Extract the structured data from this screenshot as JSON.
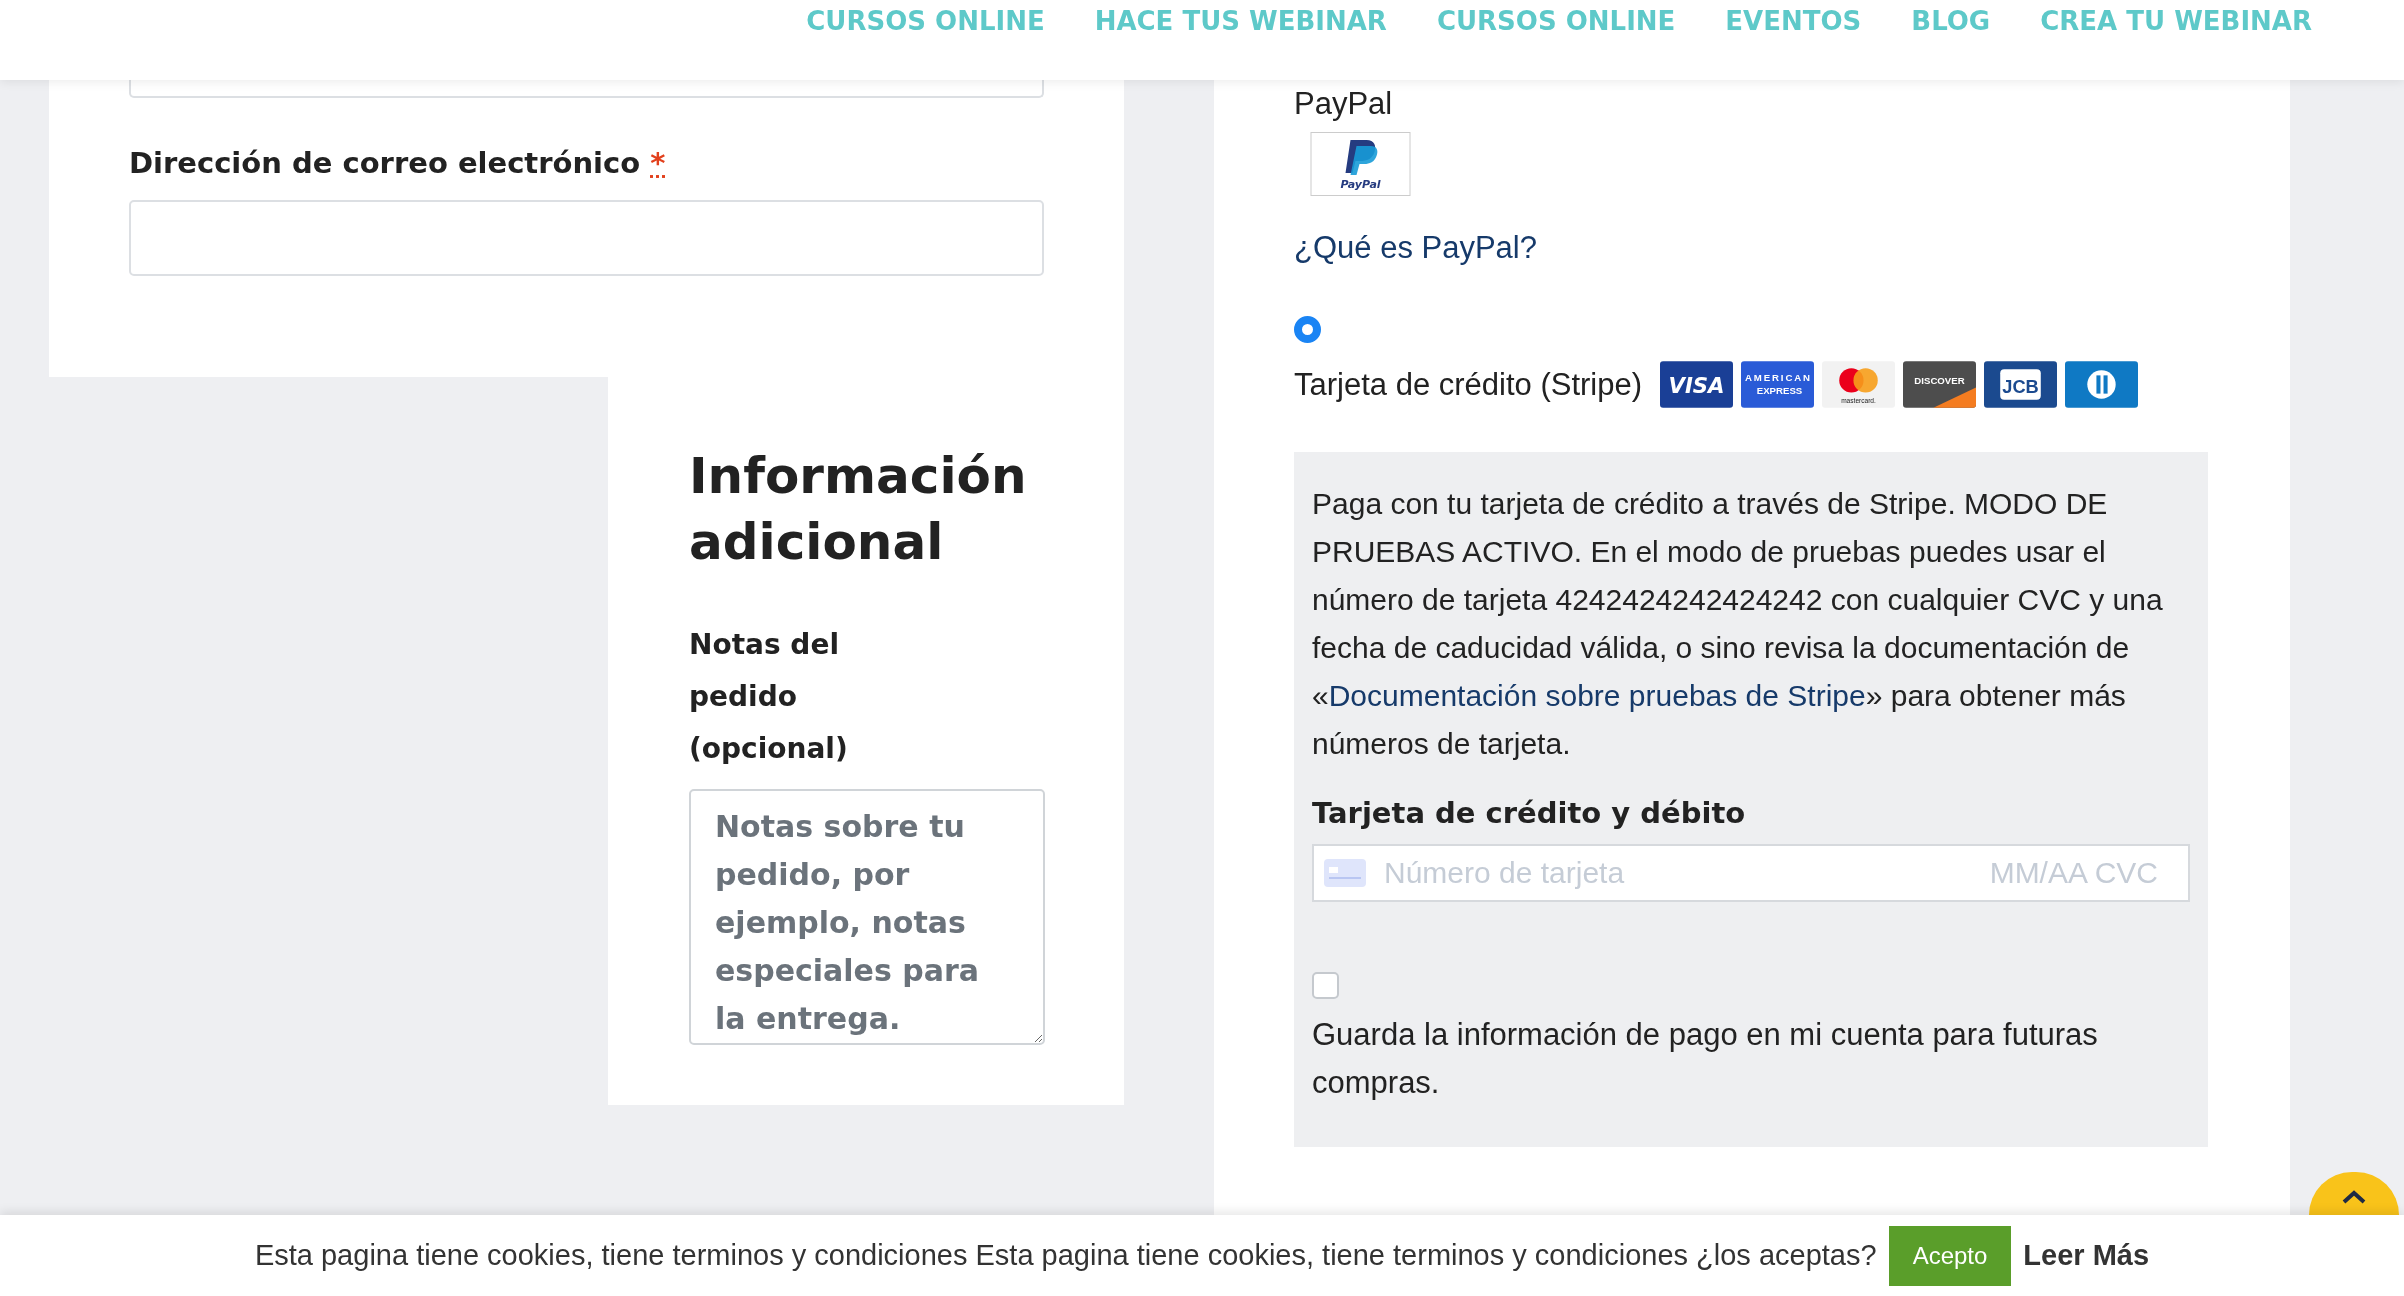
{
  "nav": [
    "CURSOS ONLINE",
    "HACE TUS WEBINAR",
    "CURSOS ONLINE",
    "EVENTOS",
    "BLOG",
    "CREA TU WEBINAR"
  ],
  "billing": {
    "email_label": "Dirección de correo electrónico",
    "required_mark": "*"
  },
  "additional": {
    "title": "Información adicional",
    "notes_label": "Notas del pedido (opcional)",
    "notes_placeholder": "Notas sobre tu pedido, por ejemplo, notas especiales para la entrega."
  },
  "payment": {
    "paypal": {
      "label": "PayPal",
      "logo_text": "PayPal",
      "link": "¿Qué es PayPal?"
    },
    "stripe": {
      "selected": true,
      "label": "Tarjeta de crédito (Stripe)",
      "cards": [
        {
          "kind": "visa",
          "text": "VISA"
        },
        {
          "kind": "amex",
          "text": "AMERICAN EXPRESS"
        },
        {
          "kind": "mastercard",
          "text": "mastercard."
        },
        {
          "kind": "discover",
          "text": "DISCOVER"
        },
        {
          "kind": "jcb",
          "text": "JCB"
        },
        {
          "kind": "diners"
        }
      ],
      "description_before": "Paga con tu tarjeta de crédito a través de Stripe. MODO DE PRUEBAS ACTIVO. En el modo de pruebas puedes usar el número de tarjeta 4242424242424242 con cualquier CVC y una fecha de caducidad válida, o sino revisa la documentación de «",
      "description_link": "Documentación sobre pruebas de Stripe",
      "description_after": "» para obtener más números de tarjeta.",
      "card_label": "Tarjeta de crédito y débito",
      "card_placeholder": "Número de tarjeta",
      "expiry_placeholder": "MM/AA CVC",
      "save_checked": false,
      "save_label": "Guarda la información de pago en mi cuenta para futuras compras."
    }
  },
  "cookie": {
    "text": "Esta pagina tiene cookies, tiene terminos y condiciones Esta pagina tiene cookies, tiene terminos y condiciones ¿los aceptas?",
    "accept": "Acepto",
    "more": "Leer Más"
  }
}
